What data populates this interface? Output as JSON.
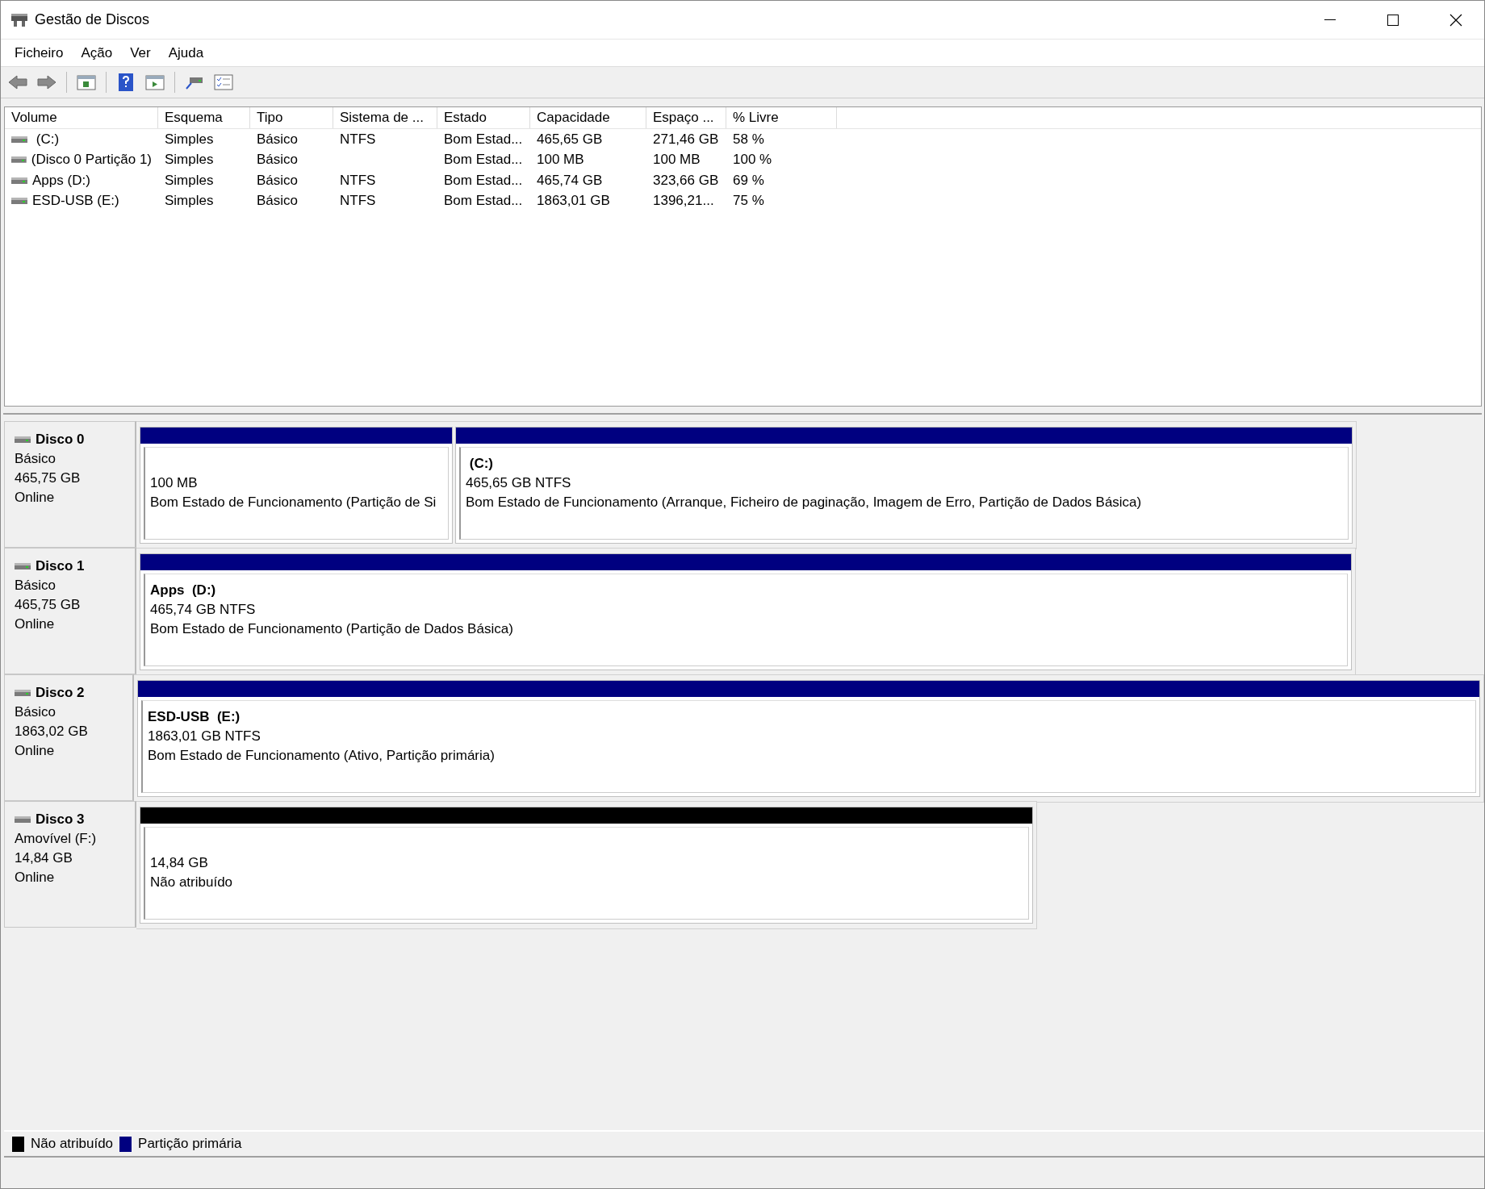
{
  "window": {
    "title": "Gestão de Discos"
  },
  "menu": [
    "Ficheiro",
    "Ação",
    "Ver",
    "Ajuda"
  ],
  "table": {
    "columns": [
      "Volume",
      "Esquema",
      "Tipo",
      "Sistema de ...",
      "Estado",
      "Capacidade",
      "Espaço ...",
      "% Livre"
    ],
    "rows": [
      {
        "cells": [
          " (C:)",
          "Simples",
          "Básico",
          "NTFS",
          "Bom Estad...",
          "465,65 GB",
          "271,46 GB",
          "58 %"
        ]
      },
      {
        "cells": [
          "(Disco 0 Partição 1)",
          "Simples",
          "Básico",
          "",
          "Bom Estad...",
          "100 MB",
          "100 MB",
          "100 %"
        ]
      },
      {
        "cells": [
          "Apps (D:)",
          "Simples",
          "Básico",
          "NTFS",
          "Bom Estad...",
          "465,74 GB",
          "323,66 GB",
          "69 %"
        ]
      },
      {
        "cells": [
          "ESD-USB (E:)",
          "Simples",
          "Básico",
          "NTFS",
          "Bom Estad...",
          "1863,01 GB",
          "1396,21...",
          "75 %"
        ]
      }
    ]
  },
  "disks": [
    {
      "name": "Disco 0",
      "type": "Básico",
      "size": "465,75 GB",
      "status": "Online",
      "removable": false,
      "partitions": [
        {
          "kind": "primary",
          "size": "100 MB",
          "status": "Bom Estado de Funcionamento (Partição de Si"
        },
        {
          "kind": "primary",
          "label": " (C:)",
          "size": "465,65 GB NTFS",
          "status": "Bom Estado de Funcionamento (Arranque, Ficheiro de paginação, Imagem de Erro, Partição de Dados Básica)"
        }
      ]
    },
    {
      "name": "Disco 1",
      "type": "Básico",
      "size": "465,75 GB",
      "status": "Online",
      "removable": false,
      "partitions": [
        {
          "kind": "primary",
          "label": "Apps  (D:)",
          "size": "465,74 GB NTFS",
          "status": "Bom Estado de Funcionamento (Partição de Dados Básica)"
        }
      ]
    },
    {
      "name": "Disco 2",
      "type": "Básico",
      "size": "1863,02 GB",
      "status": "Online",
      "removable": false,
      "partitions": [
        {
          "kind": "primary",
          "label": "ESD-USB  (E:)",
          "size": "1863,01 GB NTFS",
          "status": "Bom Estado de Funcionamento (Ativo, Partição primária)"
        }
      ]
    },
    {
      "name": "Disco 3",
      "type": "Amovível (F:)",
      "size": "14,84 GB",
      "status": "Online",
      "removable": true,
      "partitions": [
        {
          "kind": "unallocated",
          "size": "14,84 GB",
          "status": "Não atribuído"
        }
      ]
    }
  ],
  "legend": [
    {
      "label": "Não atribuído",
      "color": "#000000"
    },
    {
      "label": "Partição primária",
      "color": "#000080"
    }
  ]
}
